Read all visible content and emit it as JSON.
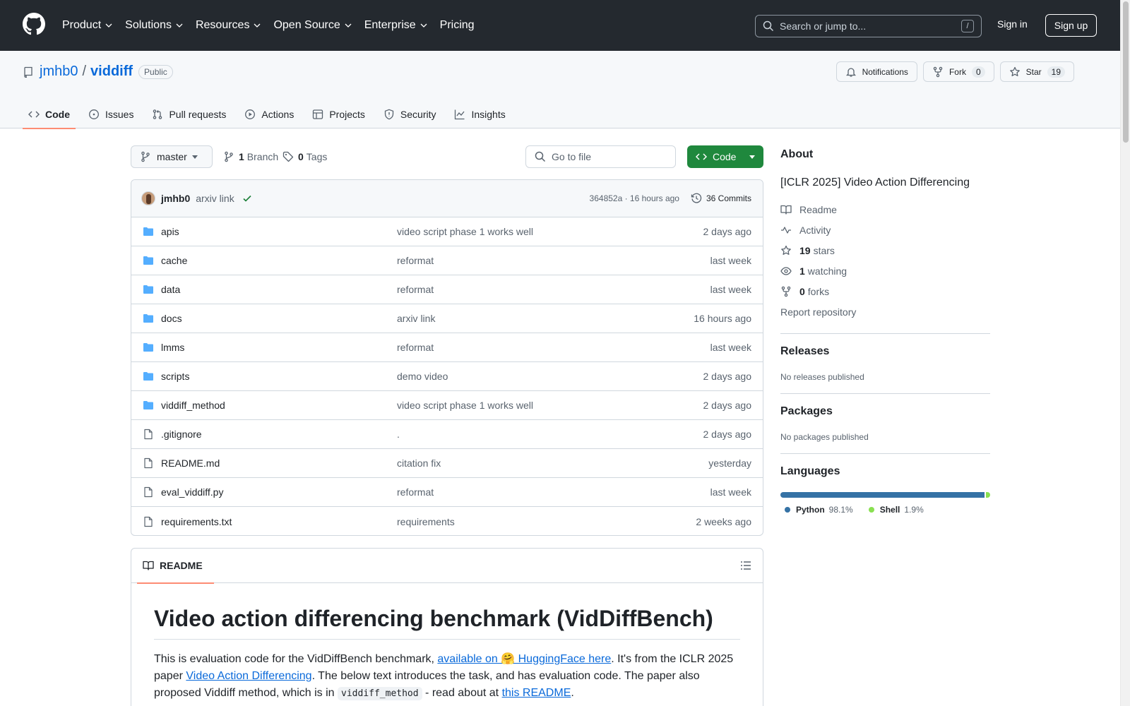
{
  "header": {
    "nav": [
      "Product",
      "Solutions",
      "Resources",
      "Open Source",
      "Enterprise",
      "Pricing"
    ],
    "search_placeholder": "Search or jump to...",
    "search_shortcut": "/",
    "sign_in": "Sign in",
    "sign_up": "Sign up"
  },
  "repo": {
    "owner": "jmhb0",
    "separator": "/",
    "name": "viddiff",
    "visibility": "Public",
    "notifications_label": "Notifications",
    "fork_label": "Fork",
    "fork_count": "0",
    "star_label": "Star",
    "star_count": "19",
    "tabs": [
      "Code",
      "Issues",
      "Pull requests",
      "Actions",
      "Projects",
      "Security",
      "Insights"
    ]
  },
  "toolbar": {
    "branch": "master",
    "branch_count": "1",
    "branch_label": "Branch",
    "tag_count": "0",
    "tag_label": "Tags",
    "goto_placeholder": "Go to file",
    "code_button": "Code"
  },
  "latest_commit": {
    "author": "jmhb0",
    "message": "arxiv link",
    "meta": "364852a · 16 hours ago",
    "commits_count_label": "36 Commits"
  },
  "files": [
    {
      "name": "apis",
      "type": "dir",
      "commit": "video script phase 1 works well",
      "time": "2 days ago"
    },
    {
      "name": "cache",
      "type": "dir",
      "commit": "reformat",
      "time": "last week"
    },
    {
      "name": "data",
      "type": "dir",
      "commit": "reformat",
      "time": "last week"
    },
    {
      "name": "docs",
      "type": "dir",
      "commit": "arxiv link",
      "time": "16 hours ago"
    },
    {
      "name": "lmms",
      "type": "dir",
      "commit": "reformat",
      "time": "last week"
    },
    {
      "name": "scripts",
      "type": "dir",
      "commit": "demo video",
      "time": "2 days ago"
    },
    {
      "name": "viddiff_method",
      "type": "dir",
      "commit": "video script phase 1 works well",
      "time": "2 days ago"
    },
    {
      "name": ".gitignore",
      "type": "file",
      "commit": ".",
      "time": "2 days ago"
    },
    {
      "name": "README.md",
      "type": "file",
      "commit": "citation fix",
      "time": "yesterday"
    },
    {
      "name": "eval_viddiff.py",
      "type": "file",
      "commit": "reformat",
      "time": "last week"
    },
    {
      "name": "requirements.txt",
      "type": "file",
      "commit": "requirements",
      "time": "2 weeks ago"
    }
  ],
  "readme": {
    "tab_label": "README",
    "title": "Video action differencing benchmark (VidDiffBench)",
    "p_1": "This is evaluation code for the VidDiffBench benchmark, ",
    "link_1": "available on 🤗 HuggingFace here",
    "p_2": ". It's from the ICLR 2025 paper ",
    "link_2": "Video Action Differencing",
    "p_3": ". The below text introduces the task, and has evaluation code. The paper also proposed Viddiff method, which is in ",
    "code_1": "viddiff_method",
    "p_4": " - read about at ",
    "link_3": "this README",
    "p_5": "."
  },
  "about": {
    "heading": "About",
    "description": "[ICLR 2025] Video Action Differencing",
    "readme": "Readme",
    "activity": "Activity",
    "stars_count": "19",
    "stars_label": "stars",
    "watching_count": "1",
    "watching_label": "watching",
    "forks_count": "0",
    "forks_label": "forks",
    "report": "Report repository"
  },
  "releases": {
    "heading": "Releases",
    "empty": "No releases published"
  },
  "packages": {
    "heading": "Packages",
    "empty": "No packages published"
  },
  "languages": {
    "heading": "Languages",
    "items": [
      {
        "name": "Python",
        "percent": "98.1%",
        "value": 98.1,
        "color": "#3572A5"
      },
      {
        "name": "Shell",
        "percent": "1.9%",
        "value": 1.9,
        "color": "#89e051"
      }
    ]
  },
  "colors": {
    "header_bg": "#24292f",
    "accent": "#0969da",
    "primary_button": "#1f883d",
    "tab_underline": "#fd8c73",
    "folder": "#54aeff"
  }
}
